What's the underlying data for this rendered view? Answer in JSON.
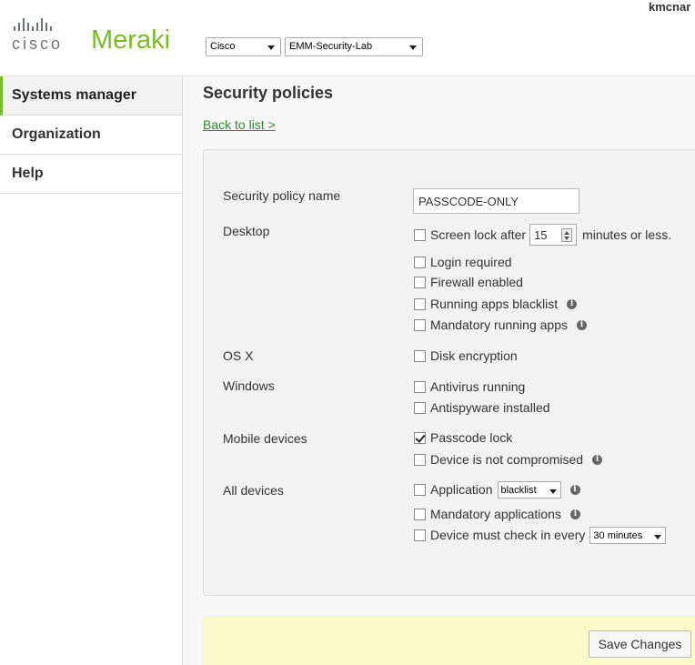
{
  "header": {
    "brand_cisco": "cisco",
    "brand_meraki": "Meraki",
    "user": "kmcnar",
    "org_select": "Cisco",
    "network_select": "EMM-Security-Lab"
  },
  "sidebar": {
    "items": [
      {
        "label": "Systems manager",
        "active": true
      },
      {
        "label": "Organization"
      },
      {
        "label": "Help"
      }
    ]
  },
  "main": {
    "title": "Security policies",
    "back_link": "Back to list >",
    "form": {
      "name_label": "Security policy name",
      "name_value": "PASSCODE-ONLY",
      "desktop_label": "Desktop",
      "screen_lock_prefix": "Screen lock after",
      "screen_lock_minutes": "15",
      "screen_lock_suffix": "minutes or less.",
      "login_required": "Login required",
      "firewall_enabled": "Firewall enabled",
      "running_apps_blacklist": "Running apps blacklist",
      "mandatory_running_apps": "Mandatory running apps",
      "osx_label": "OS X",
      "disk_encryption": "Disk encryption",
      "windows_label": "Windows",
      "antivirus_running": "Antivirus running",
      "antispyware_installed": "Antispyware installed",
      "mobile_label": "Mobile devices",
      "passcode_lock": "Passcode lock",
      "device_not_compromised": "Device is not compromised",
      "all_devices_label": "All devices",
      "application": "Application",
      "application_mode": "blacklist",
      "mandatory_applications": "Mandatory applications",
      "check_in_label": "Device must check in every",
      "check_in_interval": "30 minutes"
    },
    "save_label": "Save Changes"
  },
  "colors": {
    "brand_green": "#78be20",
    "link_green": "#2f8a2f",
    "save_bar": "#fafac8"
  }
}
